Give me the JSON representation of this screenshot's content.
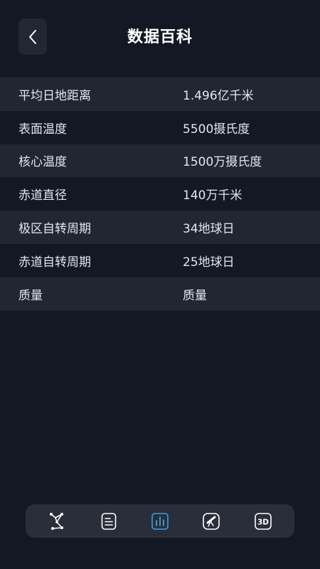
{
  "header": {
    "title": "数据百科"
  },
  "rows": [
    {
      "label": "平均日地距离",
      "value": "1.496亿千米"
    },
    {
      "label": "表面温度",
      "value": "5500摄氏度"
    },
    {
      "label": "核心温度",
      "value": "1500万摄氏度"
    },
    {
      "label": "赤道直径",
      "value": "140万千米"
    },
    {
      "label": "极区自转周期",
      "value": "34地球日"
    },
    {
      "label": "赤道自转周期",
      "value": "25地球日"
    },
    {
      "label": "质量",
      "value": "质量"
    }
  ],
  "tabbar": {
    "active_color": "#3aa0e0",
    "icon_color": "#ffffff",
    "tabs": [
      {
        "icon": "constellation-icon"
      },
      {
        "icon": "document-list-icon"
      },
      {
        "icon": "bar-chart-icon"
      },
      {
        "icon": "telescope-icon"
      },
      {
        "icon": "3d-icon",
        "label": "3D"
      }
    ]
  }
}
